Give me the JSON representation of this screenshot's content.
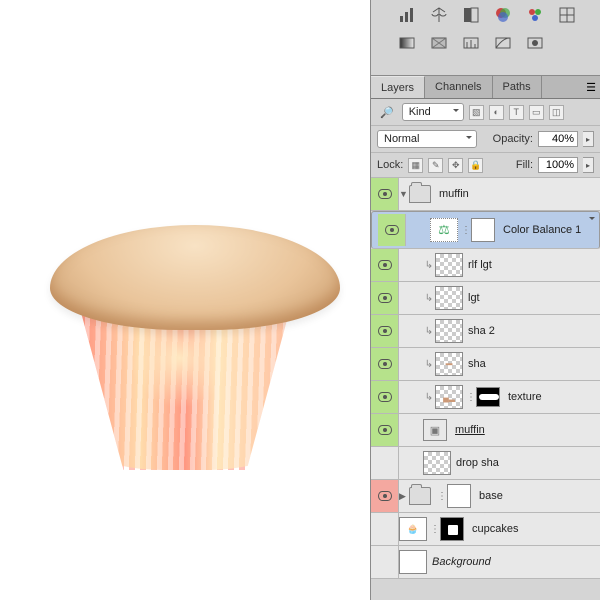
{
  "toolIcons1": [
    "histogram-icon",
    "balance-icon",
    "adjust-icon",
    "channels-icon",
    "swatches-icon",
    "grid-icon"
  ],
  "toolIcons2": [
    "gradient-icon",
    "pattern-icon",
    "levels-icon",
    "curves-icon",
    "mask-set-icon"
  ],
  "tabs": {
    "layers": "Layers",
    "channels": "Channels",
    "paths": "Paths"
  },
  "filter": {
    "kind": "Kind",
    "mode": "Normal",
    "opacityLabel": "Opacity:",
    "opacity": "40%",
    "lockLabel": "Lock:",
    "fillLabel": "Fill:",
    "fill": "100%"
  },
  "groups": {
    "muffin": "muffin",
    "base": "base"
  },
  "layers": {
    "colorBalance": "Color Balance 1",
    "rlflgt": "rlf lgt",
    "lgt": "lgt",
    "sha2": "sha 2",
    "sha": "sha",
    "texture": "texture",
    "muffin": "muffin",
    "dropsha": "drop sha",
    "cupcakes": "cupcakes",
    "background": "Background"
  }
}
